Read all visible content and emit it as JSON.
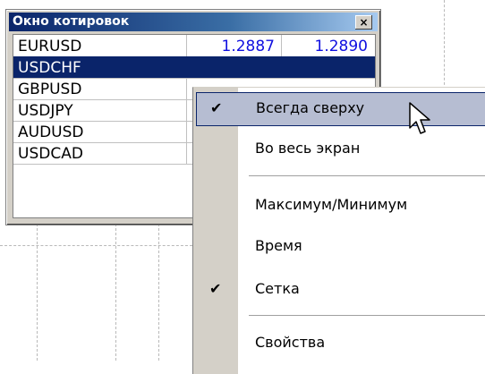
{
  "quotes_window": {
    "title": "Окно котировок",
    "close_label": "×",
    "rows": [
      {
        "symbol": "EURUSD",
        "bid": "1.2887",
        "ask": "1.2890",
        "selected": false
      },
      {
        "symbol": "USDCHF",
        "bid": "",
        "ask": "",
        "selected": true
      },
      {
        "symbol": "GBPUSD",
        "bid": "",
        "ask": "",
        "selected": false
      },
      {
        "symbol": "USDJPY",
        "bid": "",
        "ask": "",
        "selected": false
      },
      {
        "symbol": "AUDUSD",
        "bid": "",
        "ask": "",
        "selected": false
      },
      {
        "symbol": "USDCAD",
        "bid": "",
        "ask": "",
        "selected": false
      }
    ]
  },
  "context_menu": {
    "items": [
      {
        "label": "Всегда сверху",
        "checked": true,
        "highlighted": true
      },
      {
        "label": "Во весь экран",
        "checked": false,
        "highlighted": false
      },
      {
        "label": "Максимум/Минимум",
        "checked": false,
        "highlighted": false
      },
      {
        "label": "Время",
        "checked": false,
        "highlighted": false
      },
      {
        "label": "Сетка",
        "checked": true,
        "highlighted": false
      },
      {
        "label": "Свойства",
        "checked": false,
        "highlighted": false
      }
    ],
    "check_glyph": "✔"
  },
  "colors": {
    "title_bar": "#0a246a",
    "selection": "#0a246a",
    "price_text": "#1010e0",
    "menu_highlight": "#b6bdd2"
  },
  "icons": {
    "cursor": "arrow-pointer-icon",
    "close": "close-icon",
    "check": "checkmark-icon"
  }
}
